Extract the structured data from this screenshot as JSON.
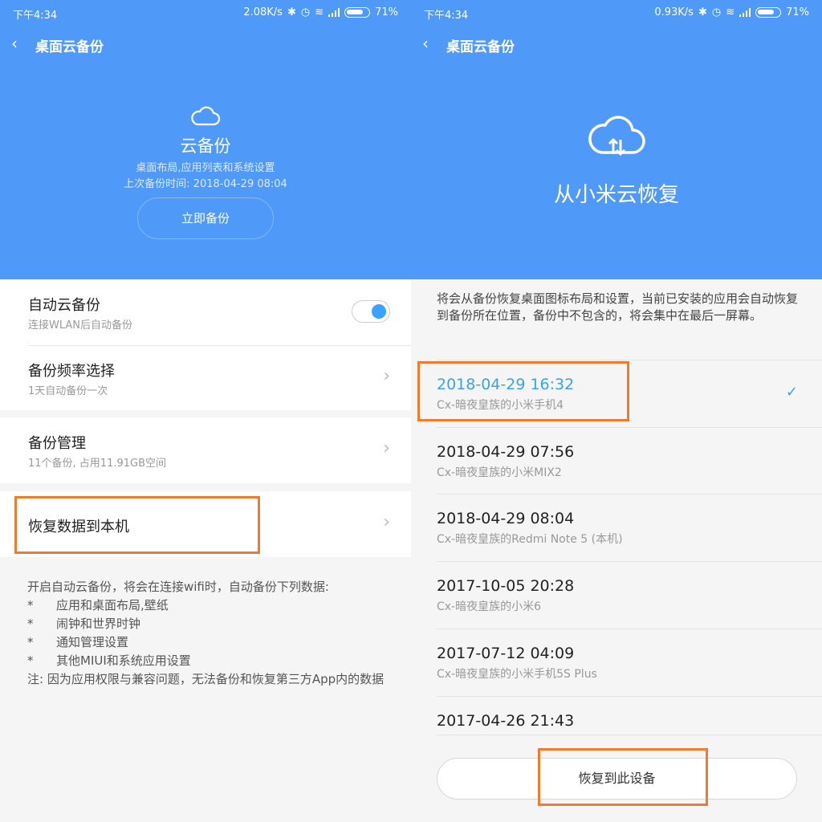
{
  "left": {
    "status": {
      "time": "下午4:34",
      "speed": "2.08K/s",
      "battery": "71%"
    },
    "title": "桌面云备份",
    "hero": {
      "title": "云备份",
      "subtitle": "桌面布局,应用列表和系统设置",
      "last_backup": "上次备份时间: 2018-04-29 08:04",
      "button": "立即备份"
    },
    "settings": [
      {
        "title": "自动云备份",
        "subtitle": "连接WLAN后自动备份"
      },
      {
        "title": "备份频率选择",
        "subtitle": "1天自动备份一次"
      },
      {
        "title": "备份管理",
        "subtitle": "11个备份, 占用11.91GB空间"
      },
      {
        "title": "恢复数据到本机"
      }
    ],
    "notes": {
      "intro": "开启自动云备份，将会在连接wifi时，自动备份下列数据:",
      "bullets": [
        "应用和桌面布局,壁纸",
        "闹钟和世界时钟",
        "通知管理设置",
        "其他MIUI和系统应用设置"
      ],
      "bullet_mark": "*",
      "footer": "注: 因为应用权限与兼容问题，无法备份和恢复第三方App内的数据"
    }
  },
  "right": {
    "status": {
      "time": "下午4:34",
      "speed": "0.93K/s",
      "battery": "71%"
    },
    "title": "桌面云备份",
    "hero_title": "从小米云恢复",
    "description": "将会从备份恢复桌面图标布局和设置，当前已安装的应用会自动恢复到备份所在位置，备份中不包含的，将会集中在最后一屏幕。",
    "backups": [
      {
        "date": "2018-04-29 16:32",
        "device": "Cx-暗夜皇族的小米手机4",
        "selected": true
      },
      {
        "date": "2018-04-29 07:56",
        "device": "Cx-暗夜皇族的小米MIX2"
      },
      {
        "date": "2018-04-29 08:04",
        "device": "Cx-暗夜皇族的Redmi Note 5 (本机)"
      },
      {
        "date": "2017-10-05 20:28",
        "device": "Cx-暗夜皇族的小米6"
      },
      {
        "date": "2017-07-12 04:09",
        "device": "Cx-暗夜皇族的小米手机5S Plus"
      },
      {
        "date": "2017-04-26 21:43"
      }
    ],
    "restore_button": "恢复到此设备"
  },
  "icons": {
    "back": "back-chevron-icon",
    "chevron": "chevron-right-icon",
    "check": "checkmark-icon",
    "cloud": "cloud-icon",
    "cloud_sync": "cloud-sync-icon"
  },
  "colors": {
    "primary": "#4f99f8",
    "accent": "#3aa3e8",
    "highlight": "#f07b2f"
  }
}
